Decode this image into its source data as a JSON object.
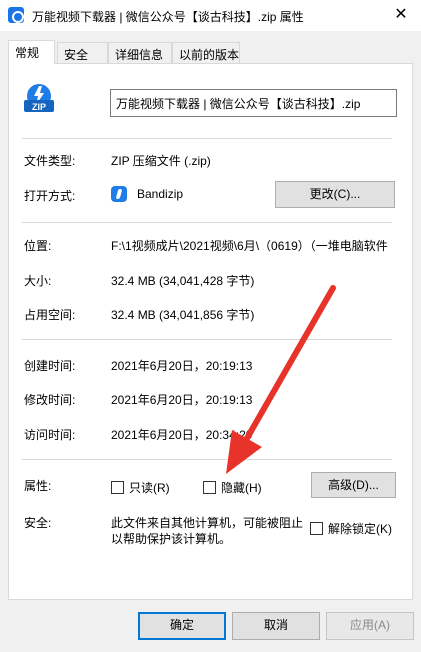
{
  "window": {
    "title": "万能视频下载器 | 微信公众号【谈古科技】.zip 属性",
    "close_glyph": "✕"
  },
  "tabs": [
    "常规",
    "安全",
    "详细信息",
    "以前的版本"
  ],
  "file": {
    "name": "万能视频下载器 | 微信公众号【谈古科技】.zip",
    "icon": "zip-file-icon"
  },
  "info": {
    "type_label": "文件类型:",
    "type_value": "ZIP 压缩文件 (.zip)",
    "opens_label": "打开方式:",
    "opens_value": "Bandizip",
    "change_button": "更改(C)...",
    "location_label": "位置:",
    "location_value": "F:\\1视频成片\\2021视频\\6月\\（0619）（一堆电脑软件",
    "size_label": "大小:",
    "size_value": "32.4 MB (34,041,428 字节)",
    "size_on_disk_label": "占用空间:",
    "size_on_disk_value": "32.4 MB (34,041,856 字节)",
    "created_label": "创建时间:",
    "created_value": "2021年6月20日，20:19:13",
    "modified_label": "修改时间:",
    "modified_value": "2021年6月20日，20:19:13",
    "accessed_label": "访问时间:",
    "accessed_value": "2021年6月20日，20:34:29",
    "attributes_label": "属性:",
    "readonly_label": "只读(R)",
    "hidden_label": "隐藏(H)",
    "advanced_button": "高级(D)...",
    "security_label": "安全:",
    "security_line1": "此文件来自其他计算机，可能被阻止",
    "security_line2": "以帮助保护该计算机。",
    "unblock_label": "解除锁定(K)"
  },
  "buttons": {
    "ok": "确定",
    "cancel": "取消",
    "apply": "应用(A)"
  },
  "colors": {
    "arrow": "#e8332a",
    "accent": "#0078d7"
  }
}
